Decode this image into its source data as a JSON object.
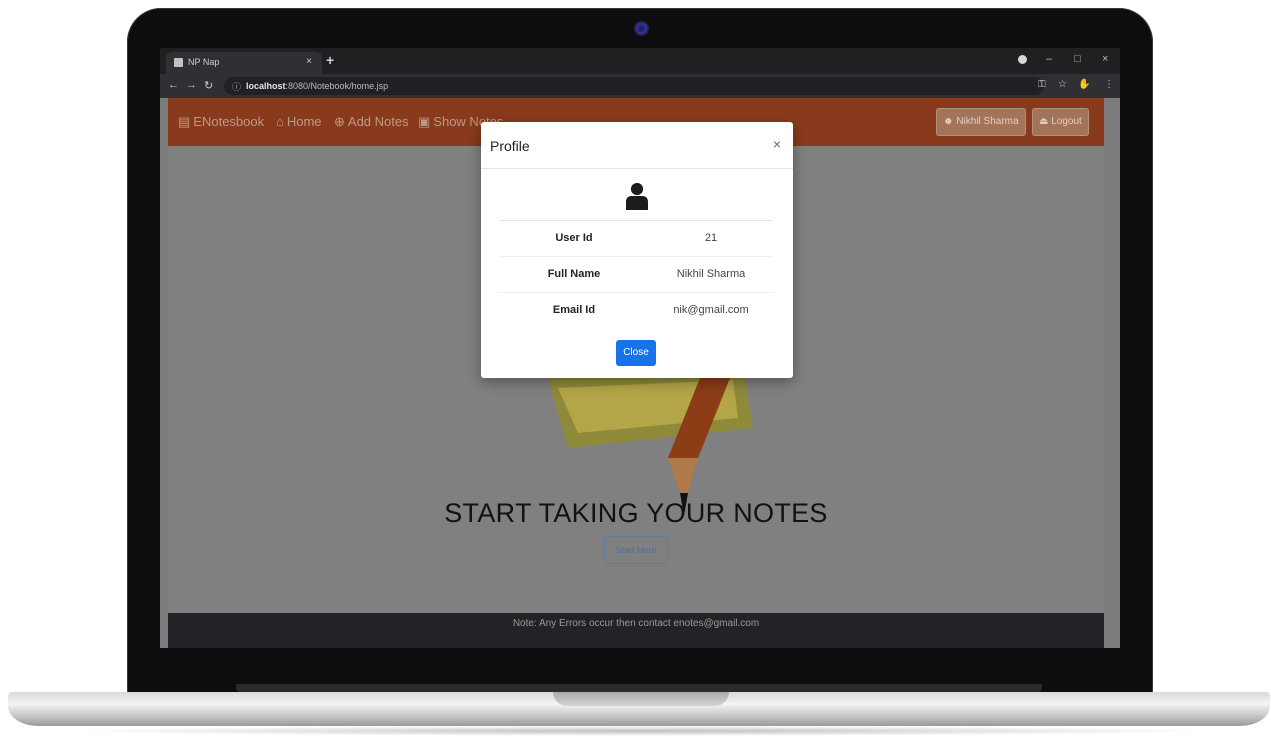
{
  "browser": {
    "tab_title": "NP Nap",
    "tab_close": "×",
    "new_tab": "+",
    "url_host": "localhost",
    "url_path": ":8080/Notebook/home.jsp",
    "window_controls": [
      "–",
      "□",
      "×"
    ]
  },
  "navbar": {
    "brand": "ENotesbook",
    "items": [
      {
        "label": "Home",
        "icon": "home-icon"
      },
      {
        "label": "Add Notes",
        "icon": "plus-circle-icon"
      },
      {
        "label": "Show Notes",
        "icon": "notes-icon"
      }
    ],
    "user_button": "Nikhil Sharma",
    "logout_button": "Logout"
  },
  "hero": {
    "title": "START TAKING YOUR NOTES",
    "button": "Start Here"
  },
  "footer": {
    "text": "Note: Any Errors occur then contact enotes@gmail.com"
  },
  "modal": {
    "title": "Profile",
    "close_symbol": "×",
    "rows": [
      {
        "label": "User Id",
        "value": "21"
      },
      {
        "label": "Full Name",
        "value": "Nikhil Sharma"
      },
      {
        "label": "Email Id",
        "value": "nik@gmail.com"
      }
    ],
    "close_button": "Close"
  },
  "colors": {
    "navbar": "#8a3a1c",
    "overlay_page": "#808080",
    "close_button": "#1673ea",
    "footer": "#222327"
  }
}
